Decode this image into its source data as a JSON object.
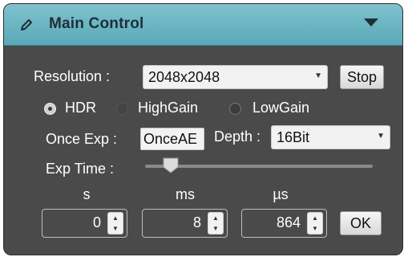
{
  "panel": {
    "title": "Main Control",
    "icons": {
      "title_icon": "pencil-icon",
      "collapse_icon": "triangle-down-icon"
    }
  },
  "resolution": {
    "label": "Resolution :",
    "selected": "2048x2048",
    "stop_label": "Stop"
  },
  "gain_mode": {
    "options": [
      {
        "label": "HDR",
        "selected": true
      },
      {
        "label": "HighGain",
        "selected": false
      },
      {
        "label": "LowGain",
        "selected": false
      }
    ]
  },
  "once_exp": {
    "label": "Once Exp :",
    "button_label": "OnceAE"
  },
  "depth": {
    "label": "Depth :",
    "selected": "16Bit"
  },
  "exp_time": {
    "label": "Exp Time :",
    "slider_fraction": 0.1
  },
  "time_fields": [
    {
      "unit": "s",
      "value": "0"
    },
    {
      "unit": "ms",
      "value": "8"
    },
    {
      "unit": "µs",
      "value": "864"
    }
  ],
  "ok_label": "OK",
  "colors": {
    "header": "#6fb8c6",
    "panel_bg": "#4a4a4a",
    "text": "#ffffff"
  }
}
